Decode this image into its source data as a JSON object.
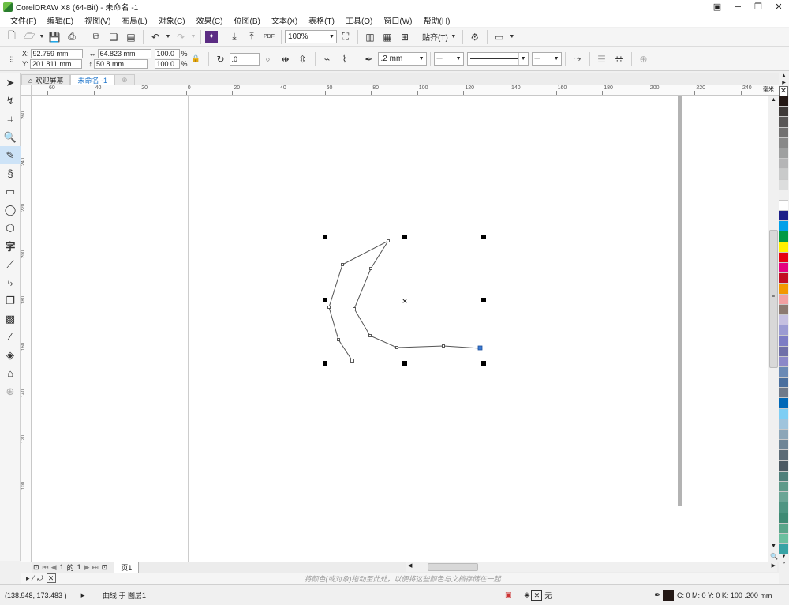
{
  "window": {
    "title": "CorelDRAW X8 (64-Bit) - 未命名 -1"
  },
  "menu": [
    "文件(F)",
    "编辑(E)",
    "视图(V)",
    "布局(L)",
    "对象(C)",
    "效果(C)",
    "位图(B)",
    "文本(X)",
    "表格(T)",
    "工具(O)",
    "窗口(W)",
    "帮助(H)"
  ],
  "toolbar": {
    "pdf_label": "PDF",
    "zoom": "100%",
    "snap_label": "贴齐(T)"
  },
  "properties": {
    "x_label": "X:",
    "x": "92.759 mm",
    "y_label": "Y:",
    "y": "201.811 mm",
    "width": "64.823 mm",
    "height": "50.8 mm",
    "scale_x": "100.0",
    "scale_y": "100.0",
    "pct": "%",
    "angle": ".0",
    "outline_width": ".2 mm"
  },
  "tabs": {
    "welcome": "欢迎屏幕",
    "document": "未命名 -1"
  },
  "ruler": {
    "h_ticks": [
      "60",
      "40",
      "20",
      "0",
      "20",
      "40",
      "60",
      "80",
      "100",
      "120",
      "140",
      "160",
      "180",
      "200",
      "220",
      "240"
    ],
    "h_unit": "毫米",
    "v_ticks": [
      "260",
      "240",
      "220",
      "200",
      "180",
      "160",
      "140",
      "120",
      "100"
    ]
  },
  "pages": {
    "current": "1",
    "of": "的",
    "total": "1",
    "tab": "页1"
  },
  "doc_palette_hint": "将颜色(或对象)拖动至此处，以便将这些颜色与文档存储在一起",
  "status": {
    "coords": "(138.948, 173.483 )",
    "object": "曲线 于 图层1",
    "fill": "无",
    "outline": "C: 0 M: 0 Y: 0 K: 100  .200 mm"
  },
  "palette_colors": [
    "#231815",
    "#3e3a39",
    "#595757",
    "#727171",
    "#898989",
    "#9fa0a0",
    "#b5b5b6",
    "#c9caca",
    "#dcdddd",
    "#efefef",
    "#ffffff",
    "#1d2088",
    "#00a0e9",
    "#009944",
    "#fff100",
    "#e60012",
    "#e4007f",
    "#c30d23",
    "#f39800",
    "#f2a0a1",
    "#8c7a70",
    "#c5c0e0",
    "#9b9bd2",
    "#7c7cc4",
    "#6f6fa8",
    "#8b88c8",
    "#6a8ab5",
    "#4a6f9e",
    "#6f7a8a",
    "#0068b7",
    "#7ecef4",
    "#a0c4dc",
    "#8ca6b8",
    "#6e8596",
    "#5b6b76",
    "#4c5a63",
    "#4f7f7a",
    "#5f9a8a",
    "#6aa595",
    "#4e9582",
    "#3f8a74",
    "#5aa58a",
    "#6bbf9f",
    "#38a3a5"
  ],
  "colors": {
    "accent": "#2277cc",
    "selection": "#000000",
    "page_shadow": "#b3b3b3"
  }
}
